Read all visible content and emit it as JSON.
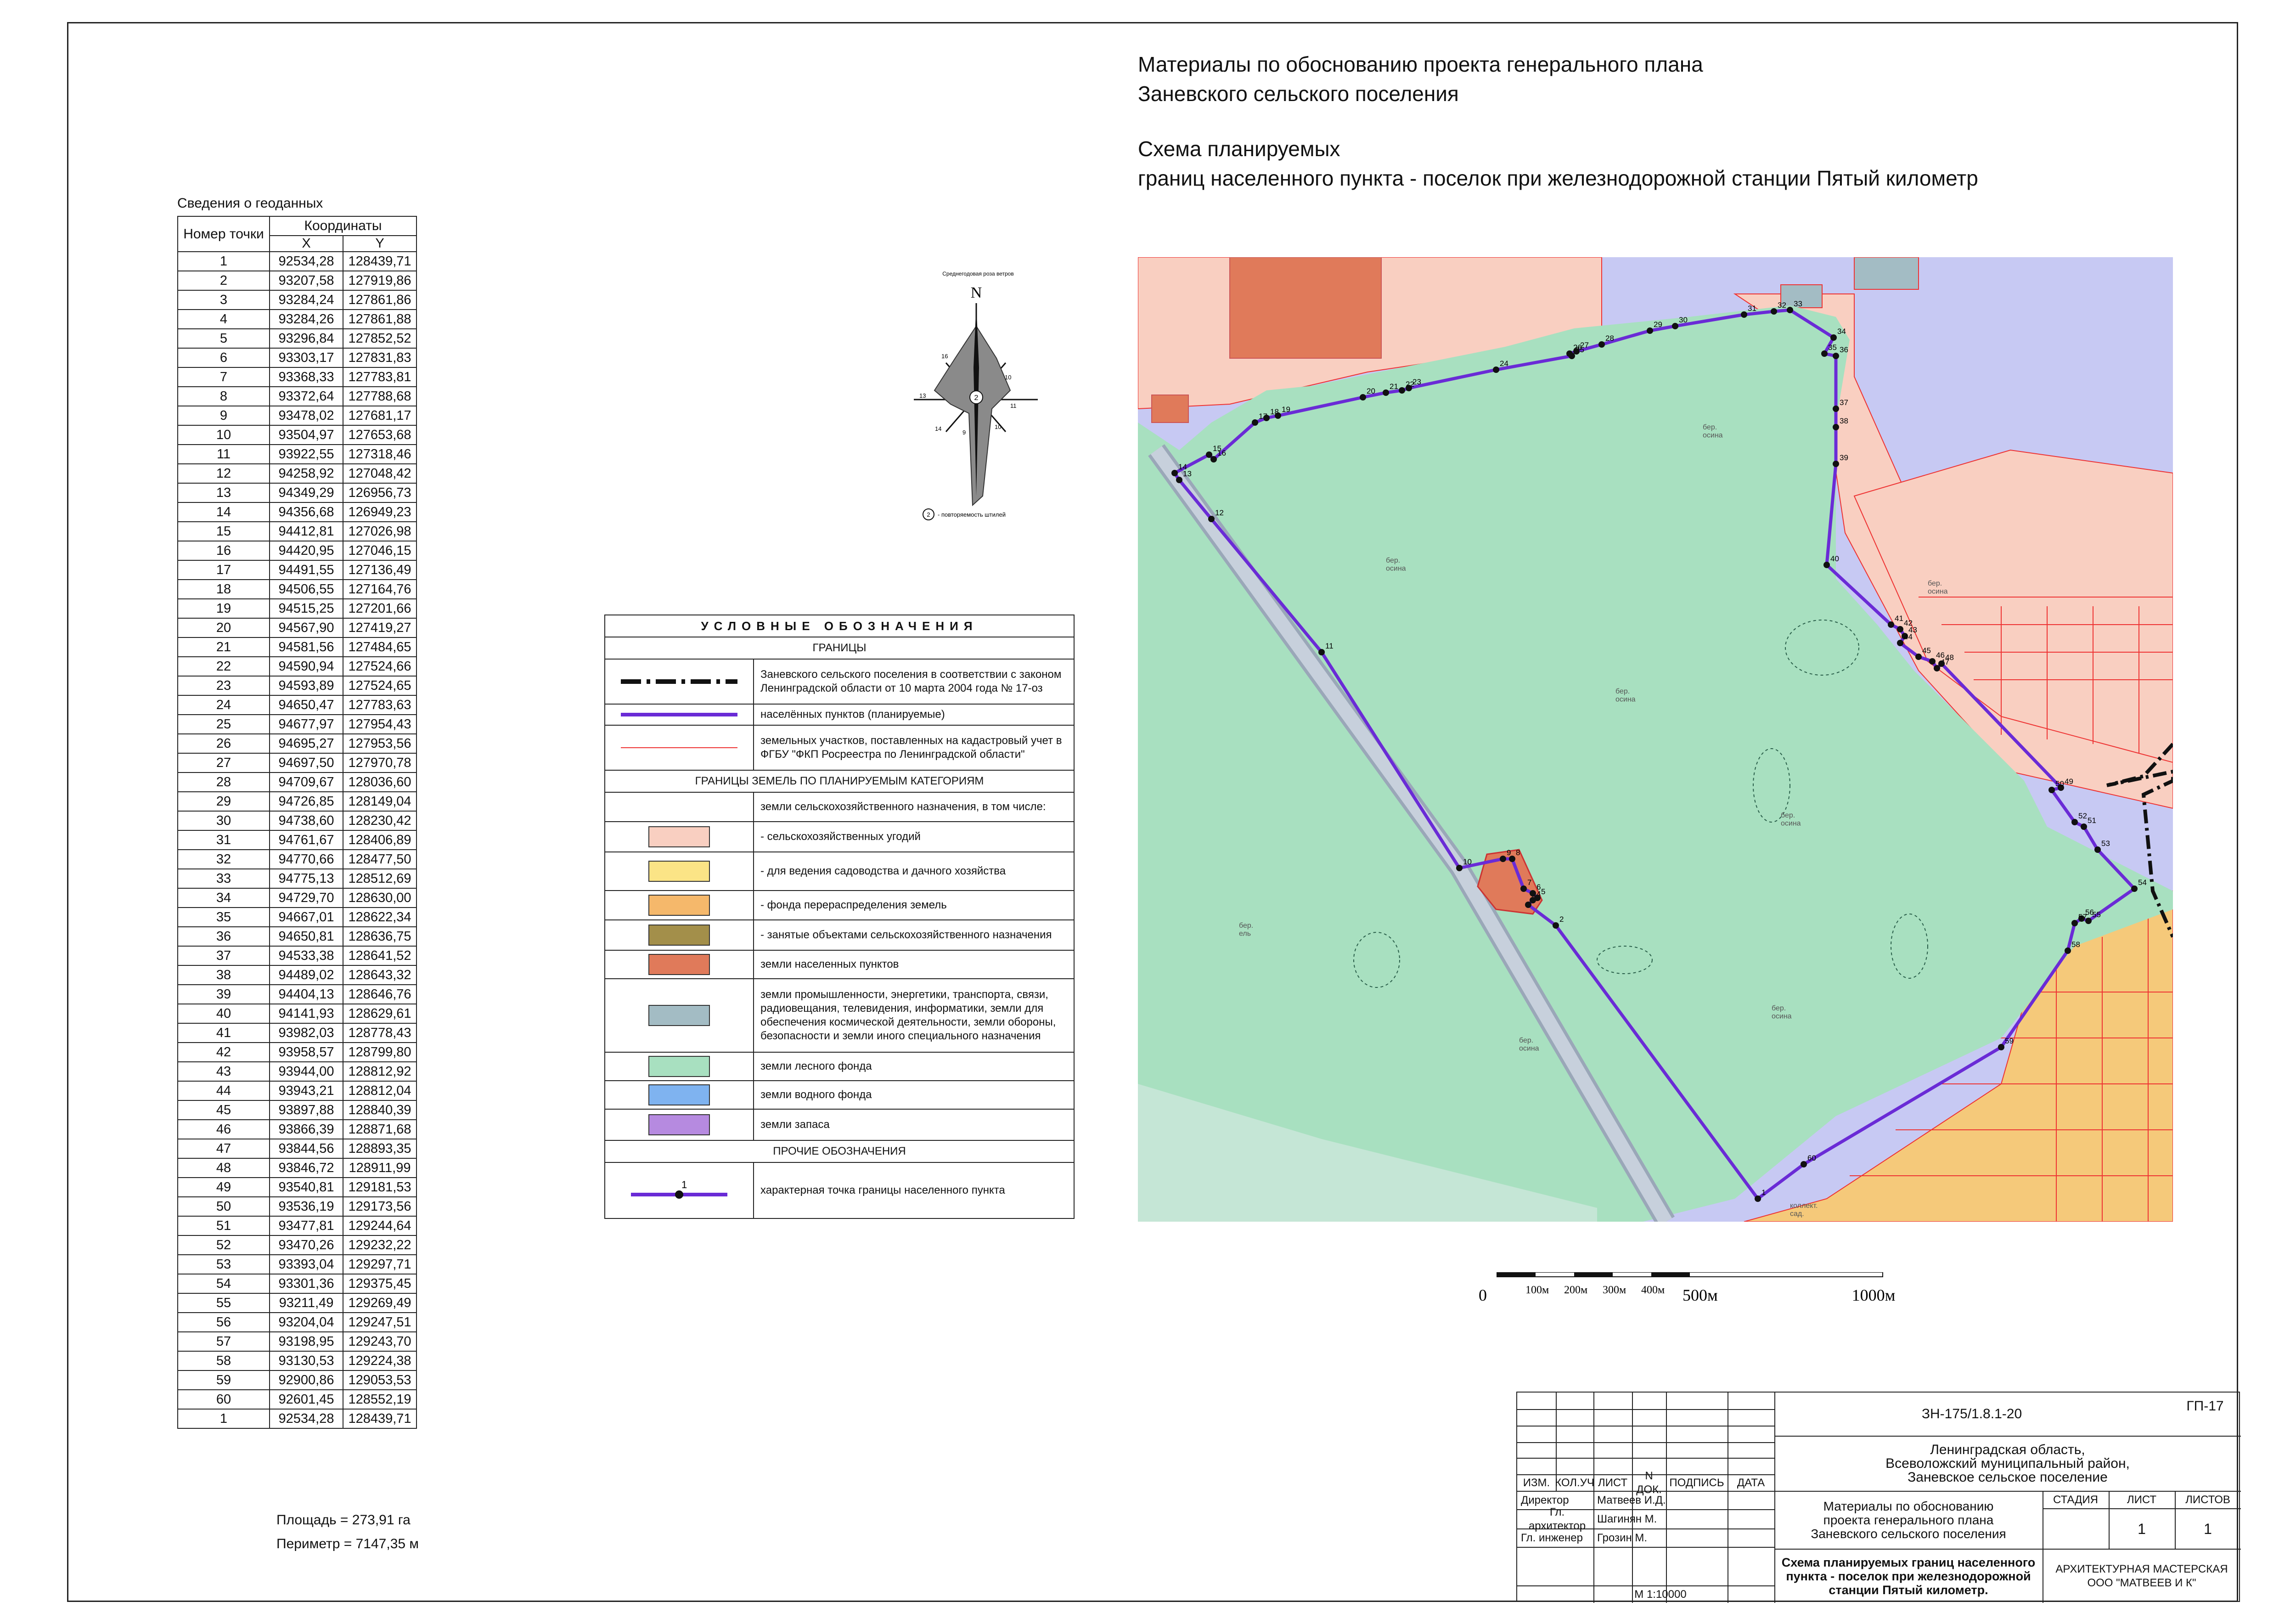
{
  "header": {
    "line1": "Материалы по обоснованию проекта генерального плана",
    "line2": "Заневского сельского поселения",
    "line3": "Схема планируемых",
    "line4": "границ населенного пункта - поселок при железнодорожной станции Пятый километр"
  },
  "geodata": {
    "caption": "Сведения о геоданных",
    "col_point": "Номер точки",
    "col_coords": "Координаты",
    "col_x": "X",
    "col_y": "Y",
    "rows": [
      [
        "1",
        "92534,28",
        "128439,71"
      ],
      [
        "2",
        "93207,58",
        "127919,86"
      ],
      [
        "3",
        "93284,24",
        "127861,86"
      ],
      [
        "4",
        "93284,26",
        "127861,88"
      ],
      [
        "5",
        "93296,84",
        "127852,52"
      ],
      [
        "6",
        "93303,17",
        "127831,83"
      ],
      [
        "7",
        "93368,33",
        "127783,81"
      ],
      [
        "8",
        "93372,64",
        "127788,68"
      ],
      [
        "9",
        "93478,02",
        "127681,17"
      ],
      [
        "10",
        "93504,97",
        "127653,68"
      ],
      [
        "11",
        "93922,55",
        "127318,46"
      ],
      [
        "12",
        "94258,92",
        "127048,42"
      ],
      [
        "13",
        "94349,29",
        "126956,73"
      ],
      [
        "14",
        "94356,68",
        "126949,23"
      ],
      [
        "15",
        "94412,81",
        "127026,98"
      ],
      [
        "16",
        "94420,95",
        "127046,15"
      ],
      [
        "17",
        "94491,55",
        "127136,49"
      ],
      [
        "18",
        "94506,55",
        "127164,76"
      ],
      [
        "19",
        "94515,25",
        "127201,66"
      ],
      [
        "20",
        "94567,90",
        "127419,27"
      ],
      [
        "21",
        "94581,56",
        "127484,65"
      ],
      [
        "22",
        "94590,94",
        "127524,66"
      ],
      [
        "23",
        "94593,89",
        "127524,65"
      ],
      [
        "24",
        "94650,47",
        "127783,63"
      ],
      [
        "25",
        "94677,97",
        "127954,43"
      ],
      [
        "26",
        "94695,27",
        "127953,56"
      ],
      [
        "27",
        "94697,50",
        "127970,78"
      ],
      [
        "28",
        "94709,67",
        "128036,60"
      ],
      [
        "29",
        "94726,85",
        "128149,04"
      ],
      [
        "30",
        "94738,60",
        "128230,42"
      ],
      [
        "31",
        "94761,67",
        "128406,89"
      ],
      [
        "32",
        "94770,66",
        "128477,50"
      ],
      [
        "33",
        "94775,13",
        "128512,69"
      ],
      [
        "34",
        "94729,70",
        "128630,00"
      ],
      [
        "35",
        "94667,01",
        "128622,34"
      ],
      [
        "36",
        "94650,81",
        "128636,75"
      ],
      [
        "37",
        "94533,38",
        "128641,52"
      ],
      [
        "38",
        "94489,02",
        "128643,32"
      ],
      [
        "39",
        "94404,13",
        "128646,76"
      ],
      [
        "40",
        "94141,93",
        "128629,61"
      ],
      [
        "41",
        "93982,03",
        "128778,43"
      ],
      [
        "42",
        "93958,57",
        "128799,80"
      ],
      [
        "43",
        "93944,00",
        "128812,92"
      ],
      [
        "44",
        "93943,21",
        "128812,04"
      ],
      [
        "45",
        "93897,88",
        "128840,39"
      ],
      [
        "46",
        "93866,39",
        "128871,68"
      ],
      [
        "47",
        "93844,56",
        "128893,35"
      ],
      [
        "48",
        "93846,72",
        "128911,99"
      ],
      [
        "49",
        "93540,81",
        "129181,53"
      ],
      [
        "50",
        "93536,19",
        "129173,56"
      ],
      [
        "51",
        "93477,81",
        "129244,64"
      ],
      [
        "52",
        "93470,26",
        "129232,22"
      ],
      [
        "53",
        "93393,04",
        "129297,71"
      ],
      [
        "54",
        "93301,36",
        "129375,45"
      ],
      [
        "55",
        "93211,49",
        "129269,49"
      ],
      [
        "56",
        "93204,04",
        "129247,51"
      ],
      [
        "57",
        "93198,95",
        "129243,70"
      ],
      [
        "58",
        "93130,53",
        "129224,38"
      ],
      [
        "59",
        "92900,86",
        "129053,53"
      ],
      [
        "60",
        "92601,45",
        "128552,19"
      ],
      [
        "1",
        "92534,28",
        "128439,71"
      ]
    ],
    "area": "Площадь = 273,91 га",
    "perimeter": "Периметр = 7147,35 м"
  },
  "compass": {
    "title": "Среднегодовая роза ветров",
    "north": "N",
    "center": "2",
    "labels": [
      "16",
      "10",
      "13",
      "11",
      "14",
      "9",
      "10"
    ],
    "note": "- повторяемость штилей"
  },
  "legend": {
    "title": "УСЛОВНЫЕ ОБОЗНАЧЕНИЯ",
    "sec_borders": "ГРАНИЦЫ",
    "b1": "Заневского сельского поселения в соответствии с законом Ленинградской области от 10 марта 2004 года № 17-оз",
    "b2": "населённых пунктов (планируемые)",
    "b3": "земельных участков, поставленных на кадастровый учет в ФГБУ \"ФКП Росреестра по Ленинградской области\"",
    "sec_cat": "ГРАНИЦЫ ЗЕМЕЛЬ ПО ПЛАНИРУЕМЫМ КАТЕГОРИЯМ",
    "c0": "земли сельскохозяйственного назначения, в том числе:",
    "c1": "- сельскохозяйственных угодий",
    "c2": "- для ведения садоводства и дачного хозяйства",
    "c3": "- фонда перераспределения земель",
    "c4": "- занятые объектами сельскохозяйственного назначения",
    "c5": "земли населенных пунктов",
    "c6": "земли промышленности, энергетики, транспорта, связи, радиовещания, телевидения, информатики, земли для обеспечения космической деятельности, земли обороны, безопасности и земли иного специального назначения",
    "c7": "земли лесного фонда",
    "c8": "земли водного фонда",
    "c9": "земли запаса",
    "sec_other": "ПРОЧИЕ ОБОЗНАЧЕНИЯ",
    "o1_num": "1",
    "o1": "характерная точка границы населенного пункта"
  },
  "colors": {
    "agri": "#f9cfc1",
    "garden": "#fbe486",
    "redistrib": "#f5b86b",
    "agri_obj": "#a38f4a",
    "settlement": "#e07a5a",
    "industry": "#a3bcc4",
    "forest": "#a8e0c0",
    "water": "#7fb3f0",
    "reserve": "#b68ae0",
    "boundary": "#6a2bd6",
    "bg_blue": "#c7c9f3"
  },
  "map": {
    "points": [
      "1",
      "2",
      "3",
      "4",
      "5",
      "6",
      "7",
      "8",
      "9",
      "10",
      "11",
      "12",
      "13",
      "14",
      "15",
      "16",
      "17",
      "18",
      "19",
      "20",
      "21",
      "22",
      "23",
      "24",
      "25",
      "26",
      "27",
      "28",
      "29",
      "30",
      "31",
      "32",
      "33",
      "34",
      "35",
      "36",
      "37",
      "38",
      "39",
      "40",
      "41",
      "42",
      "43",
      "44",
      "45",
      "46",
      "47",
      "48",
      "49",
      "50",
      "51",
      "52",
      "53",
      "54",
      "55",
      "56",
      "57",
      "58",
      "59",
      "60"
    ],
    "forest_labels": [
      "бер.\nосина",
      "бер.\nосина",
      "бер.\nосина",
      "бер.\nосина",
      "бер.\nосина",
      "бер.\nосина",
      "бер.\nосина",
      "бер.\nель"
    ],
    "kollekt": "коллект.\nсад."
  },
  "scale": {
    "zero": "0",
    "t100": "100м",
    "t200": "200м",
    "t300": "300м",
    "t400": "400м",
    "t500": "500м",
    "t1000": "1000м"
  },
  "titleblock": {
    "code": "ЗН-175/1.8.1-20",
    "sheet_code": "ГП-17",
    "region": "Ленинградская область,\nВсеволожский муниципальный район,\nЗаневское сельское поселение",
    "h_izm": "ИЗМ.",
    "h_kol": "КОЛ.УЧ",
    "h_list": "ЛИСТ",
    "h_ndok": "N ДОК.",
    "h_podp": "ПОДПИСЬ",
    "h_data": "ДАТА",
    "r1_role": "Директор",
    "r1_name": "Матвеев И.Д.",
    "r2_role": "Гл. архитектор",
    "r2_name": "Шагинян М.",
    "r3_role": "Гл. инженер",
    "r3_name": "Грозин М.",
    "scale": "М 1:10000",
    "doc_title": "Материалы по обоснованию\nпроекта генерального плана\nЗаневского сельского поселения",
    "stage_h": "СТАДИЯ",
    "list_h": "ЛИСТ",
    "lists_h": "ЛИСТОВ",
    "list_v": "1",
    "lists_v": "1",
    "drawing": "Схема планируемых границ населенного\nпункта - поселок при железнодорожной\nстанции Пятый километр.",
    "org": "АРХИТЕКТУРНАЯ МАСТЕРСКАЯ\nООО \"МАТВЕЕВ И К\""
  }
}
